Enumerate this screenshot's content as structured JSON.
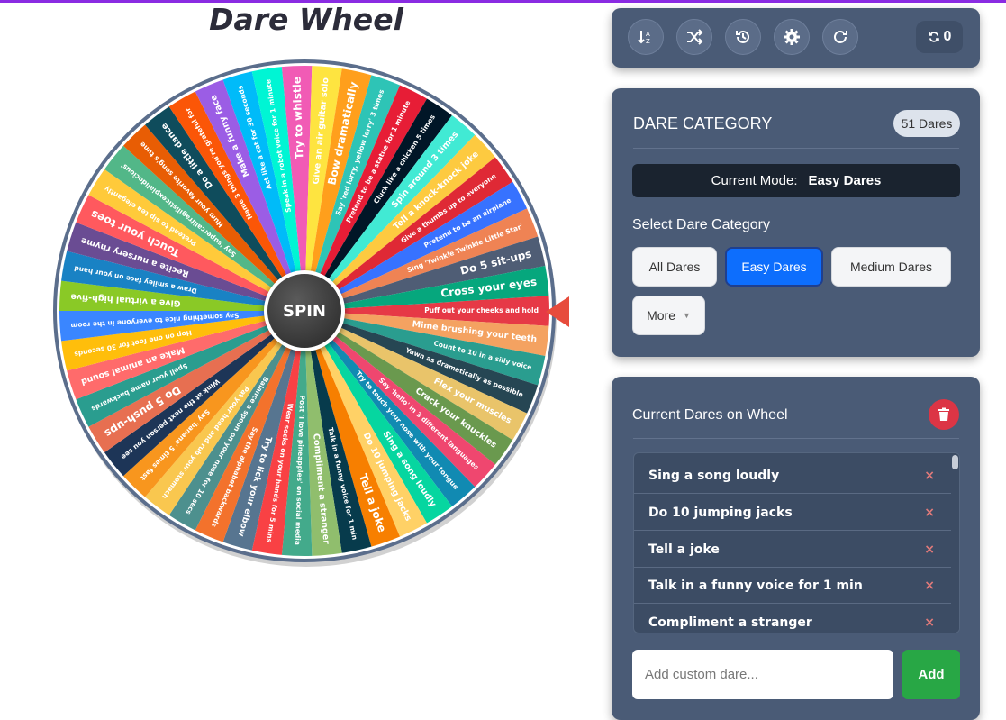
{
  "page": {
    "title": "Dare Wheel"
  },
  "wheel": {
    "spin_label": "SPIN",
    "colors": [
      "#e63946",
      "#f4a261",
      "#2a9d8f",
      "#264653",
      "#e9c46a",
      "#6a994e",
      "#ef476f",
      "#118ab2",
      "#06d6a0",
      "#ffd166",
      "#f77f00",
      "#073b4c",
      "#90be6d",
      "#43aa8b",
      "#f94144",
      "#577590",
      "#f3722c",
      "#4d908e",
      "#f9c74f",
      "#f8961e",
      "#1d3557",
      "#e76f51",
      "#2a9d8f",
      "#ff6b6b",
      "#ffbe0b",
      "#3a86ff",
      "#8ac926",
      "#1982c4",
      "#6a4c93",
      "#ff595e",
      "#ffca3a",
      "#52b788",
      "#e85d04",
      "#0f4c5c",
      "#fb5607",
      "#9b5de5",
      "#00bbf9",
      "#00f5d4",
      "#f15bb5",
      "#fee440",
      "#ff9f1c",
      "#2ec4b6",
      "#e71d36",
      "#011627",
      "#41ead4",
      "#fdca40",
      "#df2935",
      "#3772ff",
      "#ef8354",
      "#4f5d75",
      "#06a77d"
    ],
    "segments": [
      "Puff out your cheeks and hold",
      "Mime brushing your teeth",
      "Count to 10 in a silly voice",
      "Yawn as dramatically as possible",
      "Flex your muscles",
      "Crack your knuckles",
      "Say 'hello' in 3 different languages",
      "Try to touch your nose with your tongue",
      "Sing a song loudly",
      "Do 10 jumping jacks",
      "Tell a joke",
      "Talk in a funny voice for 1 min",
      "Compliment a stranger",
      "Post 'I love pineapples' on social media",
      "Wear socks on your hands for 5 mins",
      "Try to lick your elbow",
      "Say the alphabet backwards",
      "Balance a spoon on your nose for 10 secs",
      "Pat your head and rub your stomach",
      "Say 'banana' 5 times fast",
      "Wink at the next person you see",
      "Do 5 push-ups",
      "Spell your name backwards",
      "Make an animal sound",
      "Hop on one foot for 30 seconds",
      "Say something nice to everyone in the room",
      "Give a virtual high-five",
      "Draw a smiley face on your hand",
      "Recite a nursery rhyme",
      "Touch your toes",
      "Pretend to sip tea elegantly",
      "Say 'supercalifragilisticexpialidocious'",
      "Hum your favorite song's tune",
      "Do a little dance",
      "Name 3 things you're grateful for",
      "Make a funny face",
      "Act like a cat for 30 seconds",
      "Speak in a robot voice for 1 minute",
      "Try to whistle",
      "Give an air guitar solo",
      "Bow dramatically",
      "Say 'red lorry, yellow lorry' 3 times",
      "Pretend to be a statue for 1 minute",
      "Cluck like a chicken 5 times",
      "Spin around 3 times",
      "Tell a knock-knock joke",
      "Give a thumbs up to everyone",
      "Pretend to be an airplane",
      "Sing 'Twinkle Twinkle Little Star'",
      "Do 5 sit-ups",
      "Cross your eyes"
    ]
  },
  "toolbar": {
    "icons": [
      "sort-icon",
      "shuffle-icon",
      "history-icon",
      "gear-icon",
      "refresh-icon"
    ],
    "spin_count": "0"
  },
  "category": {
    "heading": "DARE CATEGORY",
    "count_badge": "51 Dares",
    "mode_label": "Current Mode:",
    "mode_value": "Easy Dares",
    "select_label": "Select Dare Category",
    "buttons": {
      "all": "All Dares",
      "easy": "Easy Dares",
      "medium": "Medium Dares",
      "more": "More"
    }
  },
  "current": {
    "heading": "Current Dares on Wheel",
    "items": [
      "Sing a song loudly",
      "Do 10 jumping jacks",
      "Tell a joke",
      "Talk in a funny voice for 1 min",
      "Compliment a stranger"
    ],
    "remove_label": "×",
    "add_placeholder": "Add custom dare...",
    "add_label": "Add"
  },
  "colors": {
    "panel": "#4a5b76",
    "primary": "#0d6efd",
    "danger": "#dc3545",
    "success": "#28a745",
    "accent": "#8a2be2"
  }
}
